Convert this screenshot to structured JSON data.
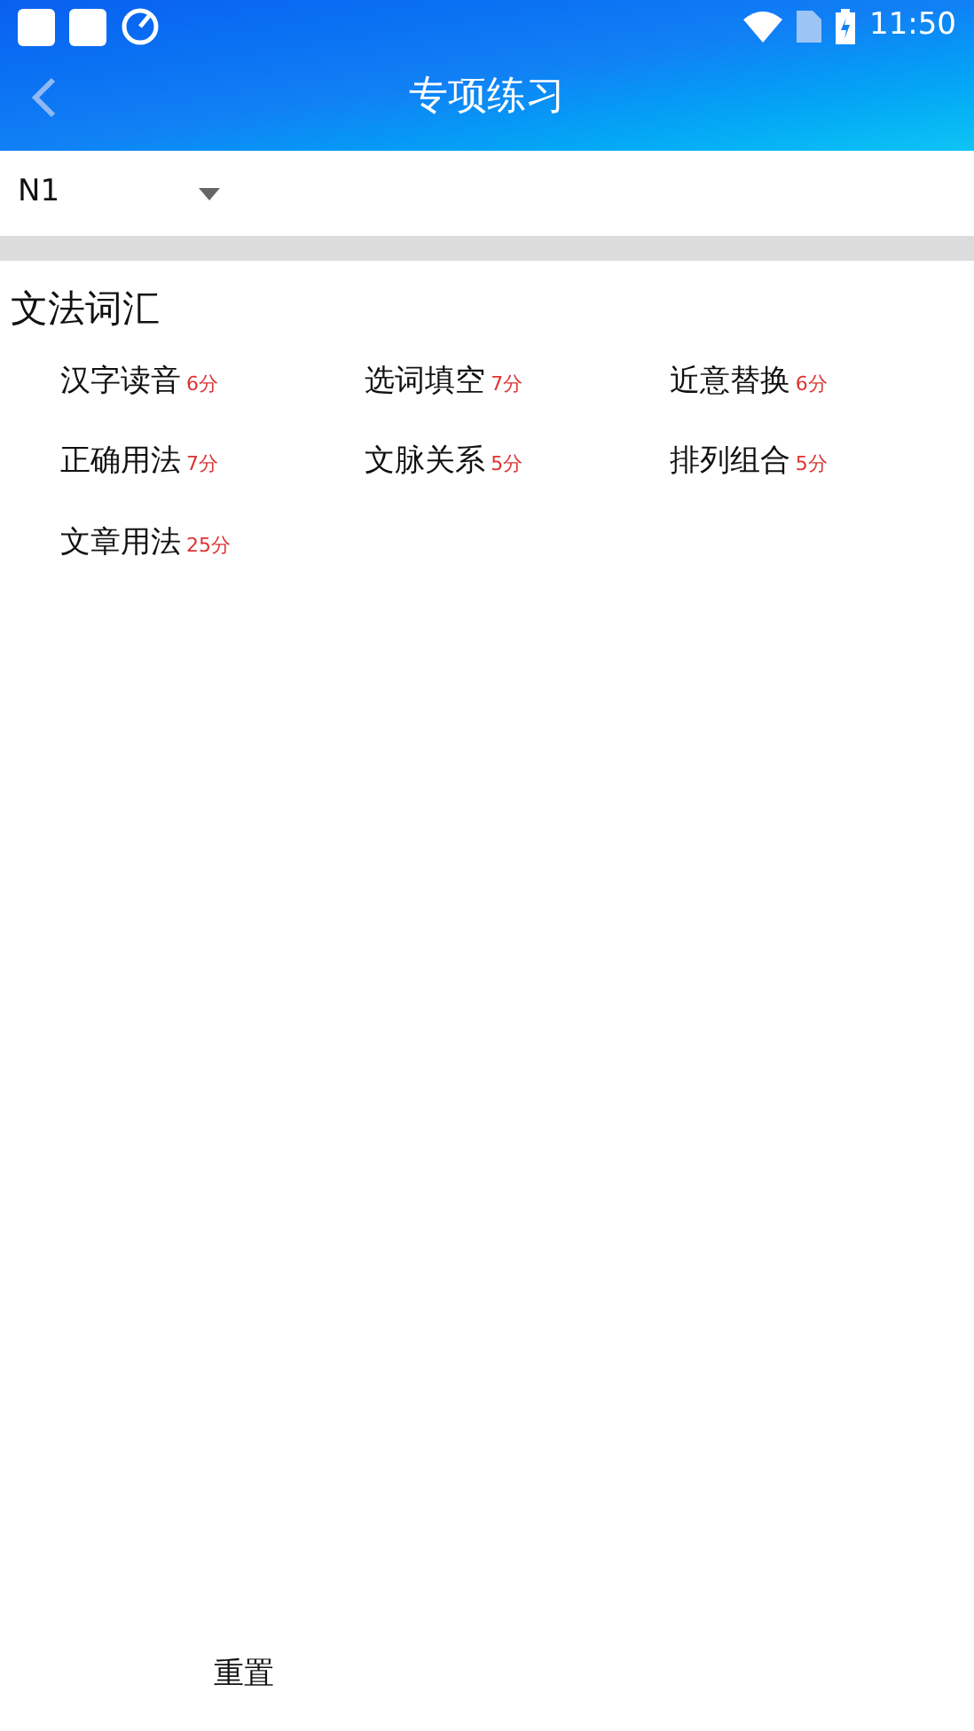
{
  "status_bar": {
    "time": "11:50"
  },
  "header": {
    "title": "专项练习"
  },
  "level_select": {
    "value": "N1"
  },
  "section": {
    "title": "文法词汇",
    "items": [
      {
        "label": "汉字读音",
        "score": "6分"
      },
      {
        "label": "选词填空",
        "score": "7分"
      },
      {
        "label": "近意替换",
        "score": "6分"
      },
      {
        "label": "正确用法",
        "score": "7分"
      },
      {
        "label": "文脉关系",
        "score": "5分"
      },
      {
        "label": "排列组合",
        "score": "5分"
      },
      {
        "label": "文章用法",
        "score": "25分"
      }
    ]
  },
  "footer": {
    "buttons": [
      "重置"
    ]
  }
}
